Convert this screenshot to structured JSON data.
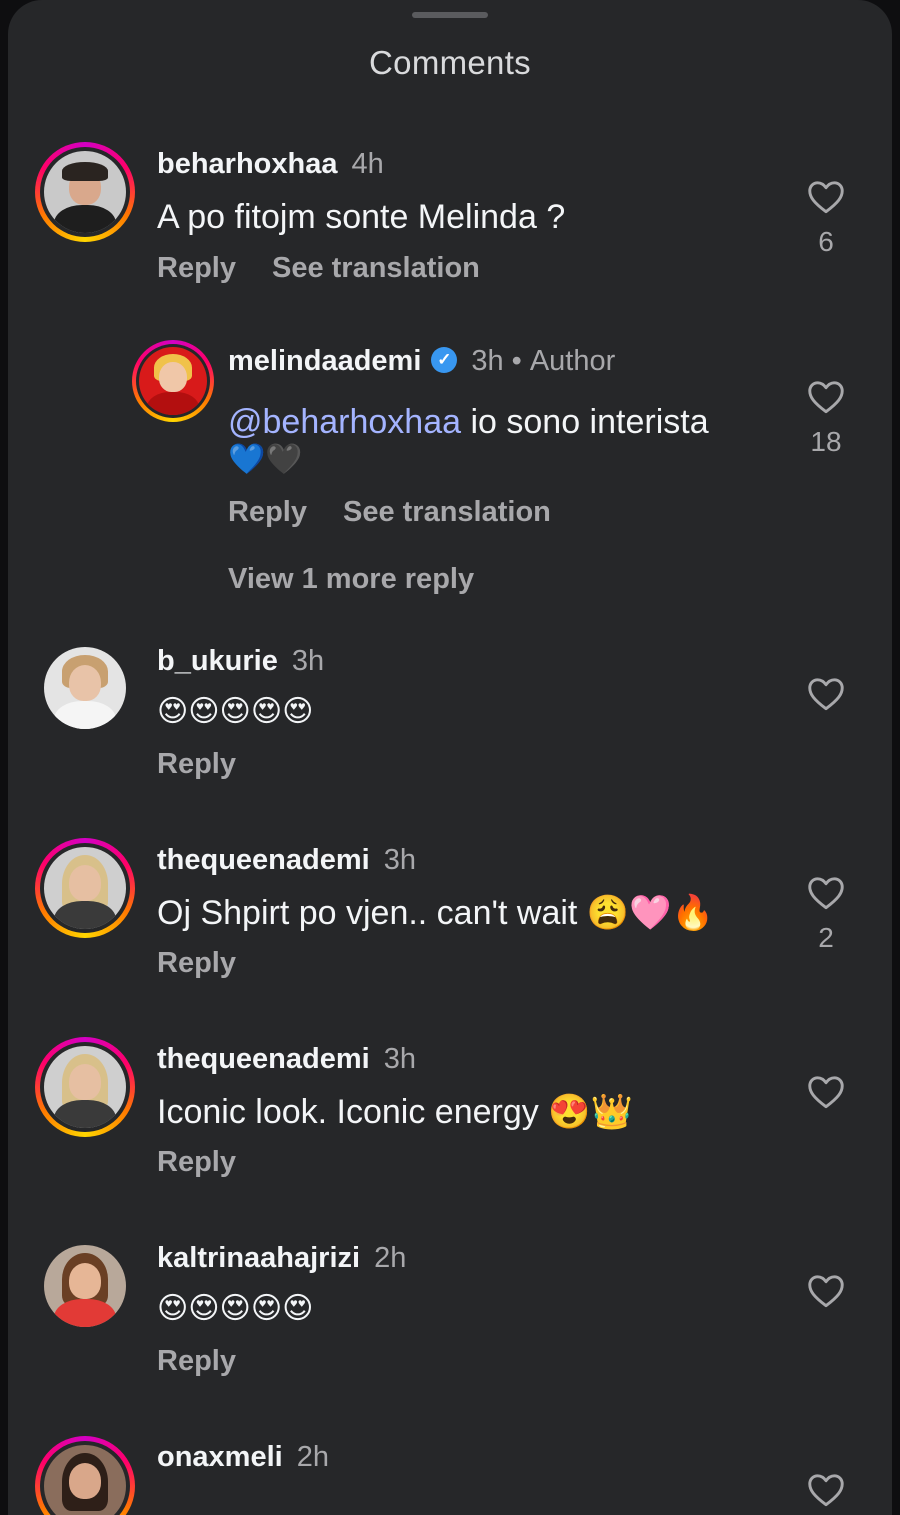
{
  "sheet": {
    "title": "Comments"
  },
  "comments": [
    {
      "username": "beharhoxhaa",
      "time": "4h",
      "text": "A po fitojm  sonte Melinda ?",
      "reply": "Reply",
      "translate": "See translation",
      "likes": "6",
      "story_ring": true,
      "avatar": "man-avatar"
    },
    {
      "username": "melindaademi",
      "time": "3h",
      "author_label": "Author",
      "verified": true,
      "mention": "@beharhoxhaa",
      "text": " io sono interista",
      "emoji_line": "💙🖤",
      "reply": "Reply",
      "translate": "See translation",
      "view_more": "View 1 more reply",
      "likes": "18",
      "story_ring": true,
      "avatar": "red-avatar"
    },
    {
      "username": "b_ukurie",
      "time": "3h",
      "text": "😍😍😍😍😍",
      "reply": "Reply",
      "likes": "",
      "story_ring": false,
      "avatar": "white-avatar"
    },
    {
      "username": "thequeenademi",
      "time": "3h",
      "text": "Oj Shpirt po vjen.. can't wait 😩🩷🔥",
      "reply": "Reply",
      "likes": "2",
      "story_ring": true,
      "avatar": "blonde-avatar"
    },
    {
      "username": "thequeenademi",
      "time": "3h",
      "text": "Iconic look. Iconic energy 😍👑",
      "reply": "Reply",
      "likes": "",
      "story_ring": true,
      "avatar": "blonde-avatar"
    },
    {
      "username": "kaltrinaahajrizi",
      "time": "2h",
      "text": "😍😍😍😍😍",
      "reply": "Reply",
      "likes": "",
      "story_ring": false,
      "avatar": "red-dress-avatar"
    },
    {
      "username": "onaxmeli",
      "time": "2h",
      "text": "",
      "reply": "",
      "likes": "",
      "story_ring": true,
      "avatar": "dark-hair-avatar"
    }
  ],
  "icons": {
    "like": "heart-outline-icon",
    "verified": "verified-badge-icon"
  },
  "colors": {
    "background": "#262729",
    "mention": "#a4b4ff",
    "verified": "#3897f0",
    "muted": "#a8a8ab"
  }
}
